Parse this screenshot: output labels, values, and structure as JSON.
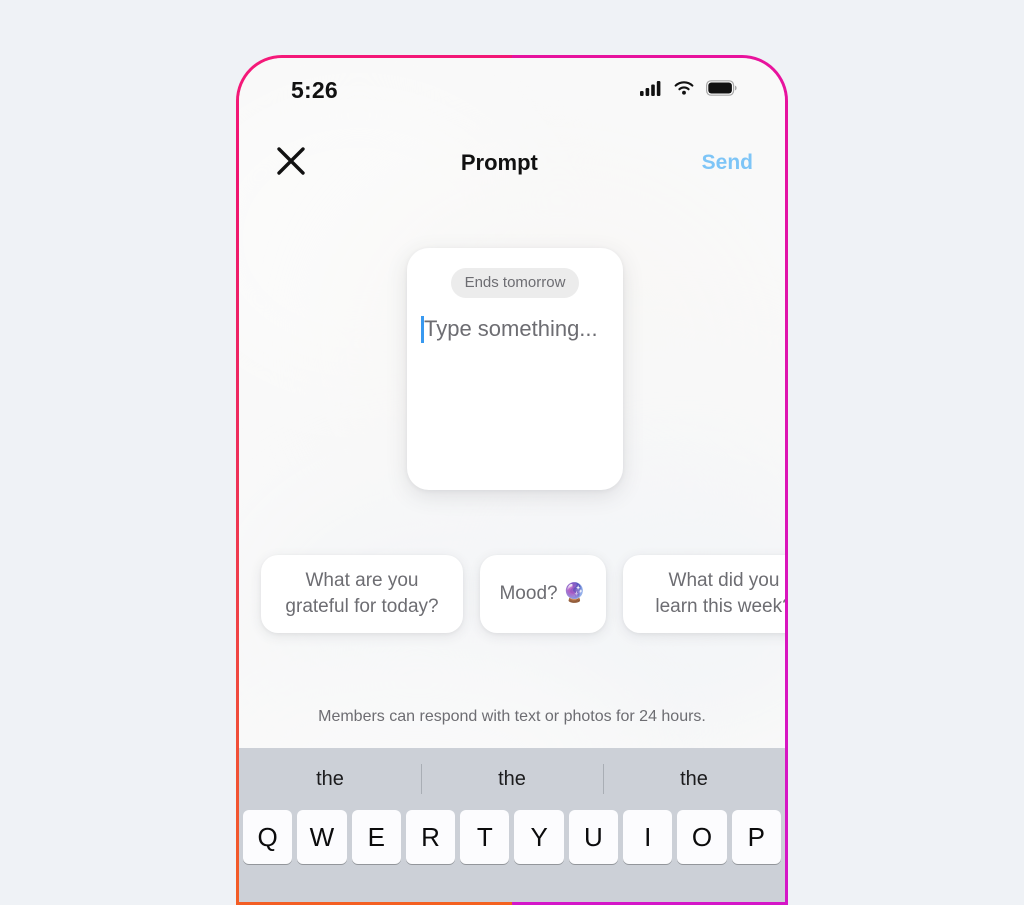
{
  "theme": {
    "page_background": "#eff2f6",
    "frame_gradient_left_top": "#f5197a",
    "frame_gradient_left_bottom": "#f4621f",
    "frame_gradient_right": "#d416c9",
    "send_color": "#7ec5f7",
    "caret_color": "#3899f0",
    "keyboard_background": "#ccd0d7",
    "muted_text": "#6d6d72"
  },
  "status_bar": {
    "time": "5:26",
    "cellular_icon": "cellular-signal-icon",
    "wifi_icon": "wifi-icon",
    "battery_icon": "battery-full-icon"
  },
  "nav": {
    "close_icon": "close-icon",
    "title": "Prompt",
    "send_label": "Send"
  },
  "prompt_card": {
    "badge": "Ends tomorrow",
    "placeholder": "Type something...",
    "caret_visible": true
  },
  "suggestions": [
    {
      "label": "What are you\ngrateful for today?"
    },
    {
      "label": "Mood? 🔮"
    },
    {
      "label": "What did you\nlearn this week?"
    }
  ],
  "footer": {
    "note": "Members can respond with text or photos for 24 hours."
  },
  "keyboard": {
    "suggestions": [
      "the",
      "the",
      "the"
    ],
    "top_row_keys": [
      "Q",
      "W",
      "E",
      "R",
      "T",
      "Y",
      "U",
      "I",
      "O",
      "P"
    ]
  }
}
